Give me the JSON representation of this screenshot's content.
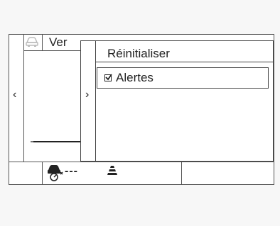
{
  "background_screen": {
    "title_partial": "Ver",
    "left_arrow": "‹",
    "icons": {
      "header": "car-icon"
    }
  },
  "panel": {
    "title": "Réinitialiser",
    "back_arrow": "›",
    "options": [
      {
        "label": "Alertes",
        "checked": true
      }
    ]
  },
  "status_bar": {
    "speed_indicator": "---",
    "icons": {
      "speed": "speed-limit-icon",
      "lane": "lane-assist-icon"
    }
  }
}
